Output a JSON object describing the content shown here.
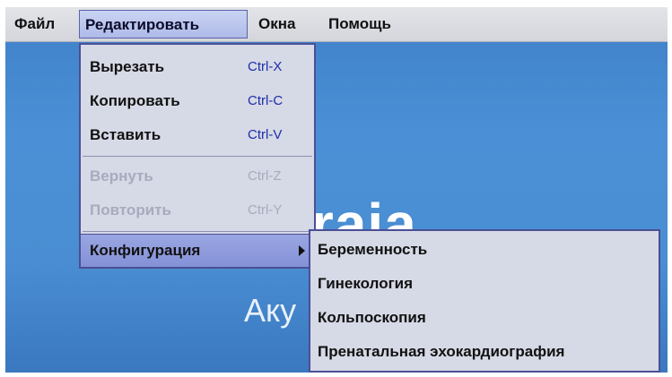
{
  "menubar": {
    "items": [
      "Файл",
      "Редактировать",
      "Окна",
      "Помощь"
    ]
  },
  "background": {
    "brand_text": "atraia",
    "brand_sub": "Aку"
  },
  "edit_menu": {
    "items": [
      {
        "label": "Вырезать",
        "shortcut": "Ctrl-X"
      },
      {
        "label": "Копировать",
        "shortcut": "Ctrl-C"
      },
      {
        "label": "Вставить",
        "shortcut": "Ctrl-V"
      },
      {
        "label": "Вернуть",
        "shortcut": "Ctrl-Z",
        "disabled": true
      },
      {
        "label": "Повторить",
        "shortcut": "Ctrl-Y",
        "disabled": true
      },
      {
        "label": "Конфигурация",
        "submenu": true
      }
    ]
  },
  "config_submenu": {
    "items": [
      "Беременность",
      "Гинекология",
      "Кольпоскопия",
      "Пренатальная эхокардиография"
    ]
  }
}
